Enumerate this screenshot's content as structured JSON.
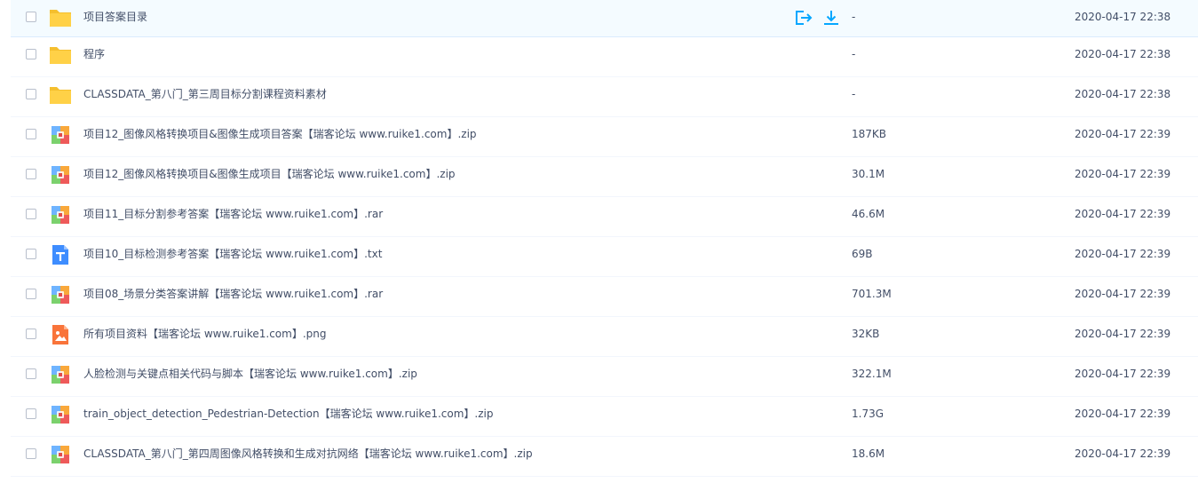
{
  "colors": {
    "accent": "#06a7ff",
    "folder": "#ffd147",
    "hover_row": "#f4fbff",
    "text": "#424e67"
  },
  "files": [
    {
      "name": "项目答案目录",
      "size": "-",
      "date": "2020-04-17 22:38",
      "icon": "folder-icon",
      "hovered": true
    },
    {
      "name": "程序",
      "size": "-",
      "date": "2020-04-17 22:38",
      "icon": "folder-icon"
    },
    {
      "name": "CLASSDATA_第八门_第三周目标分割课程资料素材",
      "size": "-",
      "date": "2020-04-17 22:38",
      "icon": "folder-icon"
    },
    {
      "name": "项目12_图像风格转换项目&图像生成项目答案【瑞客论坛 www.ruike1.com】.zip",
      "size": "187KB",
      "date": "2020-04-17 22:39",
      "icon": "archive-icon"
    },
    {
      "name": "项目12_图像风格转换项目&图像生成项目【瑞客论坛 www.ruike1.com】.zip",
      "size": "30.1M",
      "date": "2020-04-17 22:39",
      "icon": "archive-icon"
    },
    {
      "name": "项目11_目标分割参考答案【瑞客论坛 www.ruike1.com】.rar",
      "size": "46.6M",
      "date": "2020-04-17 22:39",
      "icon": "archive-icon"
    },
    {
      "name": "项目10_目标检测参考答案【瑞客论坛 www.ruike1.com】.txt",
      "size": "69B",
      "date": "2020-04-17 22:39",
      "icon": "text-file-icon"
    },
    {
      "name": "项目08_场景分类答案讲解【瑞客论坛 www.ruike1.com】.rar",
      "size": "701.3M",
      "date": "2020-04-17 22:39",
      "icon": "archive-icon"
    },
    {
      "name": "所有项目资料【瑞客论坛 www.ruike1.com】.png",
      "size": "32KB",
      "date": "2020-04-17 22:39",
      "icon": "image-file-icon"
    },
    {
      "name": "人脸检测与关键点相关代码与脚本【瑞客论坛 www.ruike1.com】.zip",
      "size": "322.1M",
      "date": "2020-04-17 22:39",
      "icon": "archive-icon"
    },
    {
      "name": "train_object_detection_Pedestrian-Detection【瑞客论坛 www.ruike1.com】.zip",
      "size": "1.73G",
      "date": "2020-04-17 22:39",
      "icon": "archive-icon"
    },
    {
      "name": "CLASSDATA_第八门_第四周图像风格转换和生成对抗网络【瑞客论坛 www.ruike1.com】.zip",
      "size": "18.6M",
      "date": "2020-04-17 22:39",
      "icon": "archive-icon"
    }
  ]
}
